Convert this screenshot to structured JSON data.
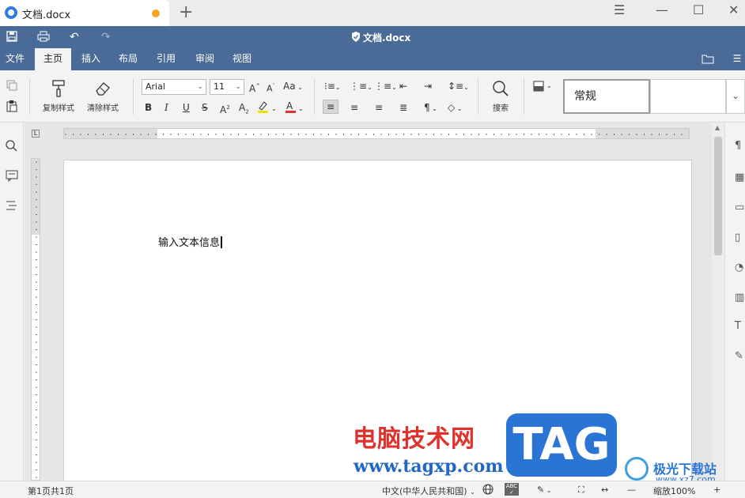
{
  "tab": {
    "title": "文档.docx",
    "new_tab": "+"
  },
  "window": {
    "menu": "☰",
    "minimize": "—",
    "maximize": "☐",
    "close": "✕"
  },
  "quickbar": {
    "title": "文档.docx",
    "save": "💾",
    "print": "⎙",
    "undo": "↶",
    "redo": "↷"
  },
  "menu": {
    "items": [
      {
        "label": "文件"
      },
      {
        "label": "主页"
      },
      {
        "label": "插入"
      },
      {
        "label": "布局"
      },
      {
        "label": "引用"
      },
      {
        "label": "审阅"
      },
      {
        "label": "视图"
      }
    ],
    "active": "主页"
  },
  "ribbon": {
    "copy_style": "复制样式",
    "clear_style": "清除样式",
    "font_name": "Arial",
    "font_size": "11",
    "search": "搜索",
    "style_current": "常规"
  },
  "document": {
    "text": "输入文本信息"
  },
  "status": {
    "pages": "第1页共1页",
    "language": "中文(中华人民共和国)",
    "zoom": "缩放100%"
  },
  "watermark": {
    "cn": "电脑技术网",
    "url": "www.tagxp.com",
    "tag": "TAG",
    "brand": "极光下载站",
    "brand_url": "www.xz7.com"
  },
  "colors": {
    "accent_bar": "#4a6b97",
    "unsaved_dot": "#f5a623",
    "highlight": "#f2e200",
    "font_color": "#e0322d"
  }
}
